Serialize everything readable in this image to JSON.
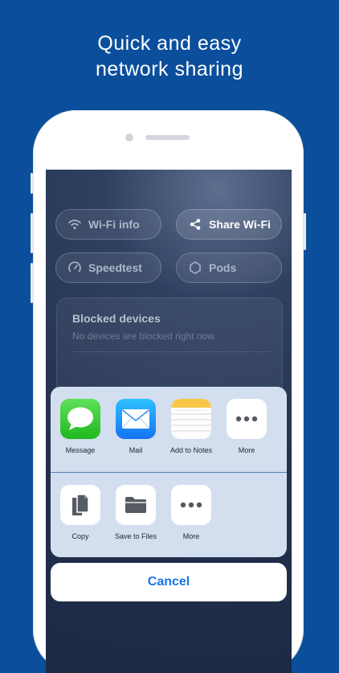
{
  "headline": {
    "line1": "Quick and easy",
    "line2": "network sharing"
  },
  "colors": {
    "background": "#0b4f9c",
    "sheet": "#d3deef",
    "cancel_text": "#1a73e8"
  },
  "app": {
    "buttons": [
      {
        "label": "Wi-Fi info",
        "icon": "wifi-icon"
      },
      {
        "label": "Share Wi-Fi",
        "icon": "share-icon"
      },
      {
        "label": "Speedtest",
        "icon": "speedometer-icon"
      },
      {
        "label": "Pods",
        "icon": "hexagon-icon"
      }
    ],
    "blocked": {
      "title": "Blocked devices",
      "subtitle": "No devices are blocked right now"
    }
  },
  "share_sheet": {
    "apps": [
      {
        "label": "Message",
        "icon": "messages-icon"
      },
      {
        "label": "Mail",
        "icon": "mail-icon"
      },
      {
        "label": "Add to Notes",
        "icon": "notes-icon"
      },
      {
        "label": "More",
        "icon": "more-icon"
      }
    ],
    "actions": [
      {
        "label": "Copy",
        "icon": "copy-icon"
      },
      {
        "label": "Save to Files",
        "icon": "folder-icon"
      },
      {
        "label": "More",
        "icon": "more-icon"
      }
    ],
    "cancel": "Cancel"
  }
}
